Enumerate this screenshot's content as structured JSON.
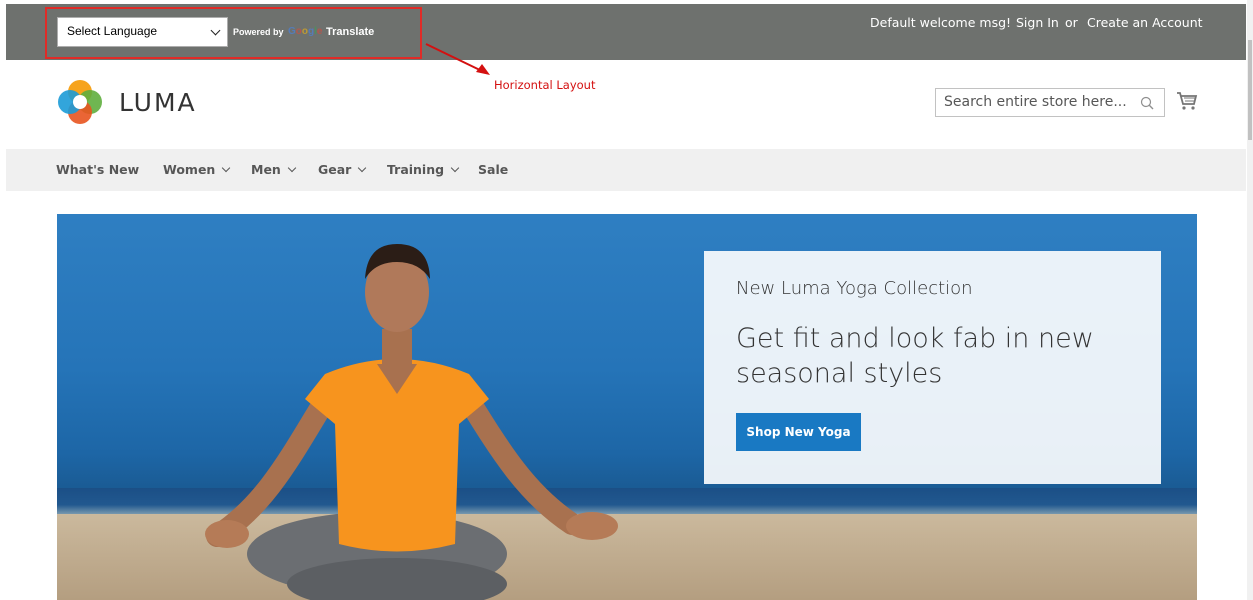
{
  "top_panel": {
    "language_select": {
      "value": "Select Language"
    },
    "powered_by": "Powered by",
    "google": "Google",
    "translate": "Translate",
    "welcome": "Default welcome msg!",
    "sign_in": "Sign In",
    "or": "or",
    "create_account": "Create an Account"
  },
  "annotation": {
    "text": "Horizontal Layout",
    "color": "#d41010"
  },
  "header": {
    "logo_text": "LUMA",
    "search": {
      "placeholder": "Search entire store here..."
    },
    "icons": [
      "search-icon",
      "cart-icon"
    ]
  },
  "nav": {
    "items": [
      {
        "label": "What's New",
        "has_dropdown": false
      },
      {
        "label": "Women",
        "has_dropdown": true
      },
      {
        "label": "Men",
        "has_dropdown": true
      },
      {
        "label": "Gear",
        "has_dropdown": true
      },
      {
        "label": "Training",
        "has_dropdown": true
      },
      {
        "label": "Sale",
        "has_dropdown": false
      }
    ]
  },
  "hero": {
    "subtitle": "New Luma Yoga Collection",
    "title": "Get fit and look fab in new seasonal styles",
    "button": "Shop New Yoga"
  },
  "colors": {
    "top_panel": "#6e716e",
    "accent": "#1979c3",
    "nav_bg": "#f0f0f0"
  }
}
